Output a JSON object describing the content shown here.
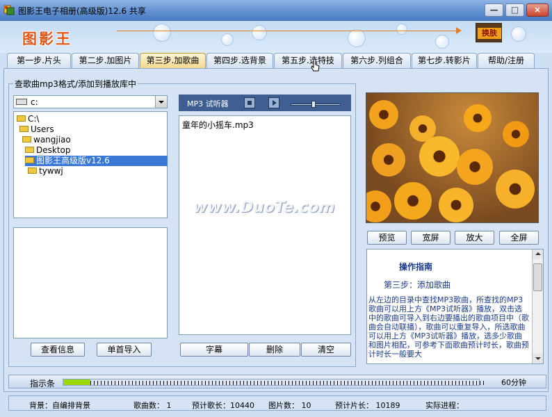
{
  "window": {
    "title": "图影王电子相册(高级版)12.6 共享",
    "controls": {
      "minimize": "—",
      "maximize": "□",
      "close": "×"
    }
  },
  "banner": {
    "logo": "图影王",
    "skin_button": "换肤"
  },
  "tabs": [
    {
      "label": "第一步.片头",
      "active": false
    },
    {
      "label": "第二步.加图片",
      "active": false
    },
    {
      "label": "第三步.加歌曲",
      "active": true
    },
    {
      "label": "第四步.选背景",
      "active": false
    },
    {
      "label": "第五步.选特技",
      "active": false
    },
    {
      "label": "第六步.列组合",
      "active": false
    },
    {
      "label": "第七步.转影片",
      "active": false
    },
    {
      "label": "帮助/注册",
      "active": false
    }
  ],
  "song_panel": {
    "group_title": "查歌曲mp3格式/添加到播放库中",
    "drive": "c:",
    "tree": [
      {
        "label": "C:\\",
        "selected": false
      },
      {
        "label": "Users",
        "selected": false
      },
      {
        "label": "wangjiao",
        "selected": false
      },
      {
        "label": "Desktop",
        "selected": false
      },
      {
        "label": "图影王高级版v12.6",
        "selected": true
      },
      {
        "label": "tywwj",
        "selected": false
      }
    ],
    "buttons": {
      "info": "查看信息",
      "import_single": "单首导入"
    }
  },
  "player": {
    "label": "MP3 试听器",
    "volume": 0.45,
    "songs": [
      "童年的小摇车.mp3"
    ],
    "buttons": {
      "subtitle": "字幕",
      "delete": "删除",
      "clear": "清空"
    }
  },
  "watermark": "www.DuoTe.com",
  "preview": {
    "buttons": {
      "preview": "预览",
      "wide": "宽屏",
      "zoom": "放大",
      "fullscreen": "全屏"
    }
  },
  "guide": {
    "title": "操作指南",
    "step": "第三步：添加歌曲",
    "text": "从左边的目录中查找MP3歌曲，所查找的MP3歌曲可以用上方《MP3试听器》播放，双击选中的歌曲可导入到右边要播出的歌曲项目中（歌曲会自动联播），歌曲可以重复导入，所选歌曲可以用上方《MP3试听器》播放，选多少歌曲和图片相配，可参考下面歌曲预计时长，歌曲预计时长一般要大"
  },
  "indicator": {
    "label": "指示条",
    "progress": 0.065,
    "time": "60分钟"
  },
  "status": {
    "background": "背景：自编排背景",
    "song_count": "歌曲数：  1",
    "song_length": "预计歌长：10440",
    "image_count": "图片数：   10",
    "film_length": "预计片长：   10189",
    "progress": "实际进程："
  },
  "colors": {
    "active_tab": "#f4d88e",
    "selection": "#3a78d8",
    "player_bar": "#3f5f92",
    "indicator_fill": "#9ad800",
    "logo": "#e2561a"
  }
}
